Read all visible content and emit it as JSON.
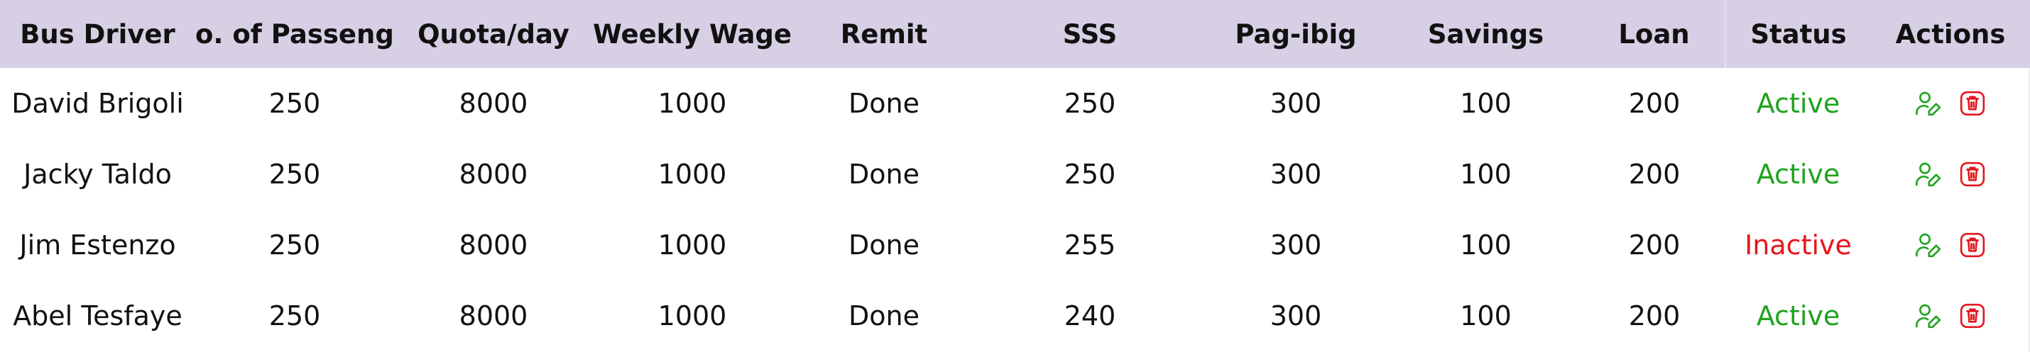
{
  "table": {
    "headers": {
      "driver": "Bus Driver",
      "passengers": "o. of Passenge",
      "quota": "Quota/day",
      "wage": "Weekly Wage",
      "remit": "Remit",
      "sss": "SSS",
      "pagibig": "Pag-ibig",
      "savings": "Savings",
      "loan": "Loan",
      "status": "Status",
      "actions": "Actions"
    },
    "rows": [
      {
        "driver": "David Brigoli",
        "passengers": "250",
        "quota": "8000",
        "wage": "1000",
        "remit": "Done",
        "sss": "250",
        "pagibig": "300",
        "savings": "100",
        "loan": "200",
        "status": "Active"
      },
      {
        "driver": "Jacky Taldo",
        "passengers": "250",
        "quota": "8000",
        "wage": "1000",
        "remit": "Done",
        "sss": "250",
        "pagibig": "300",
        "savings": "100",
        "loan": "200",
        "status": "Active"
      },
      {
        "driver": "Jim Estenzo",
        "passengers": "250",
        "quota": "8000",
        "wage": "1000",
        "remit": "Done",
        "sss": "255",
        "pagibig": "300",
        "savings": "100",
        "loan": "200",
        "status": "Inactive"
      },
      {
        "driver": "Abel Tesfaye",
        "passengers": "250",
        "quota": "8000",
        "wage": "1000",
        "remit": "Done",
        "sss": "240",
        "pagibig": "300",
        "savings": "100",
        "loan": "200",
        "status": "Active"
      }
    ],
    "row_actions": [
      {
        "name": "edit-user",
        "icon": "user-edit-icon",
        "color": "#1fa31f"
      },
      {
        "name": "delete",
        "icon": "trash-icon",
        "color": "#e5161c"
      }
    ]
  },
  "colors": {
    "header_bg": "#d7d0e5",
    "active": "#1fa31f",
    "inactive": "#e5161c",
    "text": "#111111"
  }
}
